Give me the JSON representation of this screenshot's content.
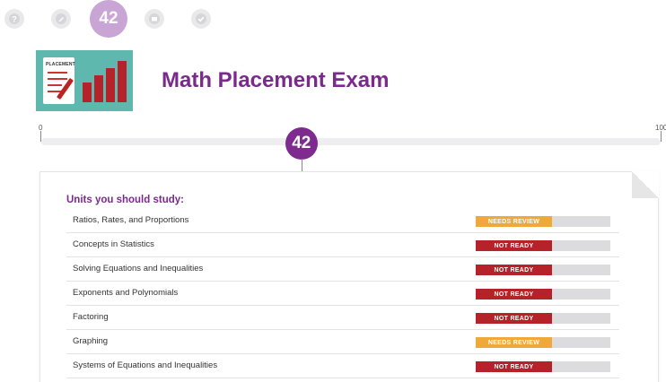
{
  "steps": {
    "current_score": "42",
    "icons": [
      "question-icon",
      "pencil-icon",
      "score-step",
      "book-icon",
      "check-icon"
    ]
  },
  "header": {
    "thumbnail_label": "PLACEMENT",
    "title": "Math Placement Exam"
  },
  "scale": {
    "min_label": "0",
    "max_label": "100",
    "score": "42",
    "score_value": 42
  },
  "units": {
    "heading": "Units you should study:",
    "items": [
      {
        "name": "Ratios, Rates, and Proportions",
        "status": "NEEDS REVIEW",
        "kind": "needs-review"
      },
      {
        "name": "Concepts in Statistics",
        "status": "NOT READY",
        "kind": "not-ready"
      },
      {
        "name": "Solving Equations and Inequalities",
        "status": "NOT READY",
        "kind": "not-ready"
      },
      {
        "name": "Exponents and Polynomials",
        "status": "NOT READY",
        "kind": "not-ready"
      },
      {
        "name": "Factoring",
        "status": "NOT READY",
        "kind": "not-ready"
      },
      {
        "name": "Graphing",
        "status": "NEEDS REVIEW",
        "kind": "needs-review"
      },
      {
        "name": "Systems of Equations and Inequalities",
        "status": "NOT READY",
        "kind": "not-ready"
      }
    ]
  },
  "colors": {
    "brand_purple": "#7a2a8c",
    "not_ready": "#b5222a",
    "needs_review": "#efa83a",
    "thumbnail_bg": "#5fb8ad"
  }
}
